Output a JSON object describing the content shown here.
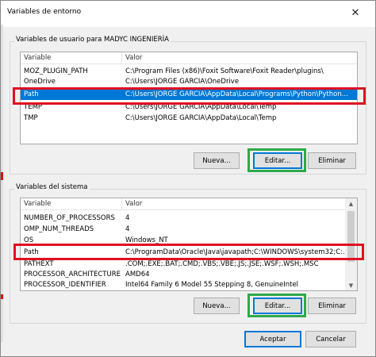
{
  "window": {
    "title": "Variables de entorno",
    "close_glyph": "✕"
  },
  "user_vars": {
    "group_label": "Variables de usuario para MADYC INGENIERÍA",
    "columns": [
      "Variable",
      "Valor"
    ],
    "rows": [
      {
        "name": "MOZ_PLUGIN_PATH",
        "value": "C:\\Program Files (x86)\\Foxit Software\\Foxit Reader\\plugins\\"
      },
      {
        "name": "OneDrive",
        "value": "C:\\Users\\JORGE GARCIA\\OneDrive"
      },
      {
        "name": "Path",
        "value": "C:\\Users\\JORGE GARCIA\\AppData\\Local\\Programs\\Python\\Python...",
        "selected": true
      },
      {
        "name": "TEMP",
        "value": "C:\\Users\\JORGE GARCIA\\AppData\\Local\\Temp"
      },
      {
        "name": "TMP",
        "value": "C:\\Users\\JORGE GARCIA\\AppData\\Local\\Temp"
      }
    ],
    "buttons": {
      "new": "Nueva...",
      "edit": "Editar...",
      "delete": "Eliminar"
    }
  },
  "system_vars": {
    "group_label": "Variables del sistema",
    "columns": [
      "Variable",
      "Valor"
    ],
    "rows": [
      {
        "name": "NUMBER_OF_PROCESSORS",
        "value": "4"
      },
      {
        "name": "OMP_NUM_THREADS",
        "value": "4"
      },
      {
        "name": "OS",
        "value": "Windows_NT"
      },
      {
        "name": "Path",
        "value": "C:\\ProgramData\\Oracle\\Java\\javapath;C:\\WINDOWS\\system32;C:..."
      },
      {
        "name": "PATHEXT",
        "value": ".COM;.EXE;.BAT;.CMD;.VBS;.VBE;.JS;.JSE;.WSF;.WSH;.MSC"
      },
      {
        "name": "PROCESSOR_ARCHITECTURE",
        "value": "AMD64"
      },
      {
        "name": "PROCESSOR_IDENTIFIER",
        "value": "Intel64 Family 6 Model 55 Stepping 8, GenuineIntel"
      }
    ],
    "buttons": {
      "new": "Nueva...",
      "edit": "Editar...",
      "delete": "Eliminar"
    }
  },
  "footer": {
    "ok": "Aceptar",
    "cancel": "Cancelar"
  },
  "colors": {
    "selection": "#0078d7",
    "highlight_red": "#e01020",
    "highlight_green": "#2ea94a"
  },
  "icons": {
    "scroll_up": "▲",
    "scroll_down": "▼",
    "scroll_left": "◀",
    "scroll_right": "▶"
  }
}
